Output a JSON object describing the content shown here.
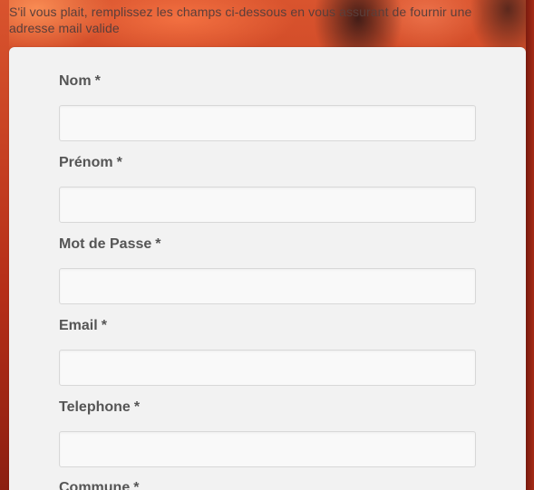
{
  "intro_text": "S'il vous plait, remplissez les champs ci-dessous en vous assurant de fournir une adresse mail valide",
  "form": {
    "required_marker": "*",
    "fields": [
      {
        "label": "Nom",
        "value": ""
      },
      {
        "label": "Prénom",
        "value": ""
      },
      {
        "label": "Mot de Passe",
        "value": ""
      },
      {
        "label": "Email",
        "value": ""
      },
      {
        "label": "Telephone",
        "value": ""
      },
      {
        "label": "Commune",
        "value": ""
      }
    ]
  },
  "colors": {
    "panel_background": "#f2f2f2",
    "label_text": "#555555",
    "input_border": "#d8d8d8",
    "page_background_accent": "#c23a1c"
  }
}
